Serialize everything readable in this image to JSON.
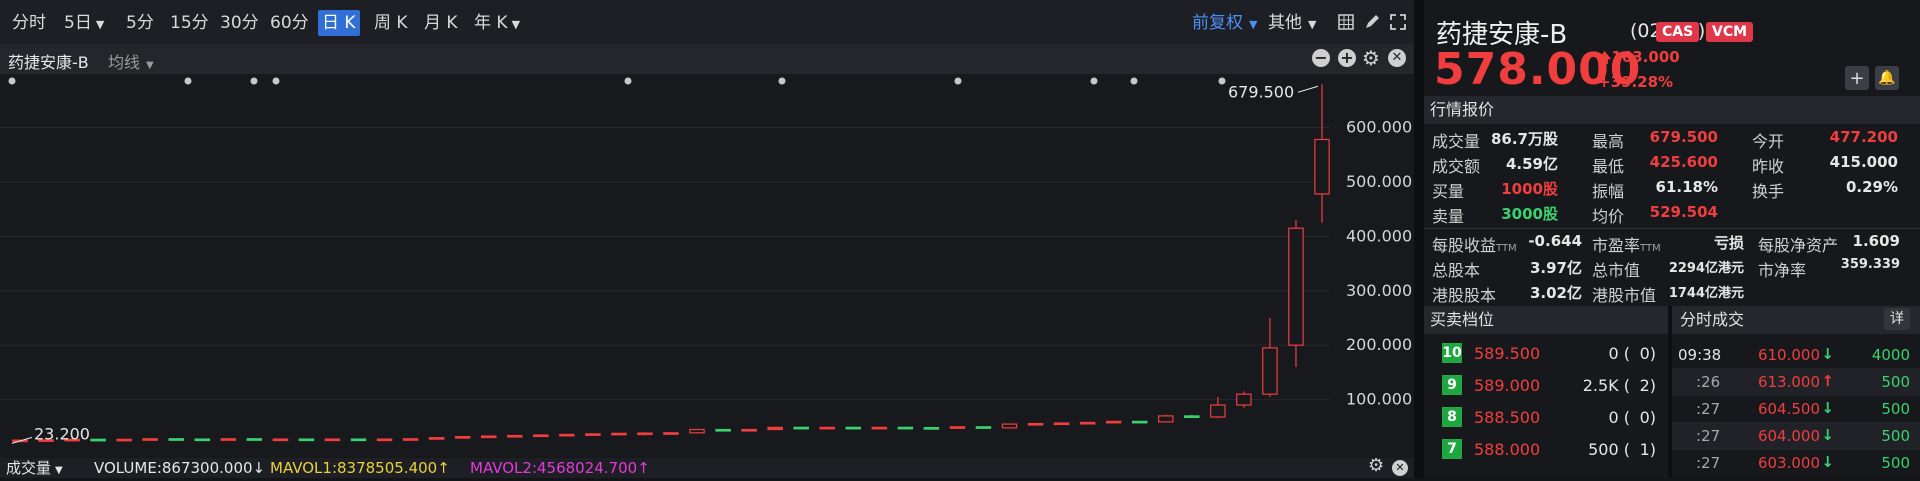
{
  "toolbar": {
    "timeframes": [
      {
        "label": "分时",
        "caret": false
      },
      {
        "label": "5日",
        "caret": true
      },
      {
        "label": "5分",
        "caret": false
      },
      {
        "label": "15分",
        "caret": false
      },
      {
        "label": "30分",
        "caret": false
      },
      {
        "label": "60分",
        "caret": false
      },
      {
        "label": "日 K",
        "caret": false,
        "active": true
      },
      {
        "label": "周 K",
        "caret": false
      },
      {
        "label": "月 K",
        "caret": false
      },
      {
        "label": "年 K",
        "caret": true
      }
    ],
    "adjust_label": "前复权",
    "other_label": "其他"
  },
  "subbar": {
    "stock_name": "药捷安康-B",
    "indicator_label": "均线"
  },
  "volume_bar": {
    "label": "成交量",
    "volume": "VOLUME:867300.000↓",
    "mavol1": "MAVOL1:8378505.400↑",
    "mavol2": "MAVOL2:4568024.700↑"
  },
  "chart_data": {
    "type": "candlestick",
    "title": "",
    "xlabel": "",
    "ylabel": "",
    "ylim": [
      0,
      680
    ],
    "y_ticks": [
      "600.000",
      "500.000",
      "400.000",
      "300.000",
      "200.000",
      "100.000"
    ],
    "y_tick_values": [
      600,
      500,
      400,
      300,
      200,
      100
    ],
    "annotations": {
      "high": "679.500",
      "low": "23.200"
    },
    "candles": [
      {
        "o": 25,
        "c": 25.5,
        "h": 26,
        "l": 23.2
      },
      {
        "o": 25.5,
        "c": 26,
        "h": 27,
        "l": 25
      },
      {
        "o": 26,
        "c": 27,
        "h": 28,
        "l": 25
      },
      {
        "o": 27,
        "c": 26.5,
        "h": 28,
        "l": 26
      },
      {
        "o": 26.5,
        "c": 27,
        "h": 28,
        "l": 26
      },
      {
        "o": 27,
        "c": 28,
        "h": 29,
        "l": 26
      },
      {
        "o": 28,
        "c": 27.5,
        "h": 29,
        "l": 27
      },
      {
        "o": 27.5,
        "c": 27,
        "h": 28,
        "l": 26
      },
      {
        "o": 27,
        "c": 28,
        "h": 29,
        "l": 26
      },
      {
        "o": 28,
        "c": 27,
        "h": 29,
        "l": 26
      },
      {
        "o": 27,
        "c": 27.5,
        "h": 28,
        "l": 26
      },
      {
        "o": 27.5,
        "c": 27,
        "h": 28,
        "l": 26
      },
      {
        "o": 27,
        "c": 27.5,
        "h": 28,
        "l": 26
      },
      {
        "o": 27.5,
        "c": 27,
        "h": 28,
        "l": 26
      },
      {
        "o": 27,
        "c": 27.5,
        "h": 28,
        "l": 26
      },
      {
        "o": 27.5,
        "c": 28,
        "h": 29,
        "l": 27
      },
      {
        "o": 28,
        "c": 30,
        "h": 31,
        "l": 27
      },
      {
        "o": 30,
        "c": 32,
        "h": 33,
        "l": 29
      },
      {
        "o": 32,
        "c": 33,
        "h": 34,
        "l": 31
      },
      {
        "o": 33,
        "c": 34,
        "h": 35,
        "l": 32
      },
      {
        "o": 34,
        "c": 35,
        "h": 36,
        "l": 33
      },
      {
        "o": 35,
        "c": 36,
        "h": 37,
        "l": 34
      },
      {
        "o": 36,
        "c": 37,
        "h": 38,
        "l": 35
      },
      {
        "o": 37,
        "c": 38,
        "h": 39,
        "l": 36
      },
      {
        "o": 38,
        "c": 38.5,
        "h": 40,
        "l": 37
      },
      {
        "o": 38.5,
        "c": 39,
        "h": 40,
        "l": 37
      },
      {
        "o": 39,
        "c": 45,
        "h": 46,
        "l": 38
      },
      {
        "o": 45,
        "c": 44,
        "h": 46,
        "l": 43
      },
      {
        "o": 44,
        "c": 45,
        "h": 46,
        "l": 43
      },
      {
        "o": 45,
        "c": 49,
        "h": 50,
        "l": 44
      },
      {
        "o": 49,
        "c": 48,
        "h": 50,
        "l": 47
      },
      {
        "o": 48,
        "c": 49,
        "h": 50,
        "l": 47
      },
      {
        "o": 49,
        "c": 48,
        "h": 50,
        "l": 47
      },
      {
        "o": 48,
        "c": 49,
        "h": 50,
        "l": 47
      },
      {
        "o": 49,
        "c": 48.5,
        "h": 50,
        "l": 47
      },
      {
        "o": 48.5,
        "c": 48,
        "h": 50,
        "l": 47
      },
      {
        "o": 48,
        "c": 50,
        "h": 51,
        "l": 47
      },
      {
        "o": 50,
        "c": 48,
        "h": 51,
        "l": 47
      },
      {
        "o": 48,
        "c": 55,
        "h": 56,
        "l": 47
      },
      {
        "o": 55,
        "c": 56,
        "h": 57,
        "l": 54
      },
      {
        "o": 56,
        "c": 57,
        "h": 58,
        "l": 55
      },
      {
        "o": 57,
        "c": 58,
        "h": 59,
        "l": 56
      },
      {
        "o": 58,
        "c": 60,
        "h": 61,
        "l": 57
      },
      {
        "o": 60,
        "c": 59,
        "h": 61,
        "l": 58
      },
      {
        "o": 59,
        "c": 70,
        "h": 72,
        "l": 58
      },
      {
        "o": 70,
        "c": 68,
        "h": 72,
        "l": 66
      },
      {
        "o": 68,
        "c": 90,
        "h": 105,
        "l": 66
      },
      {
        "o": 90,
        "c": 110,
        "h": 115,
        "l": 85
      },
      {
        "o": 110,
        "c": 195,
        "h": 250,
        "l": 105
      },
      {
        "o": 200,
        "c": 415,
        "h": 430,
        "l": 160
      },
      {
        "o": 478,
        "c": 578,
        "h": 679.5,
        "l": 425
      }
    ],
    "event_markers": 11
  },
  "quote": {
    "name": "药捷安康-B",
    "code": "(02617)",
    "badges": [
      "CAS",
      "VCM"
    ],
    "price": "578.000",
    "change": "163.000",
    "change_arrow": "🡅",
    "change_pct": "+39.28%",
    "section_title": "行情报价",
    "rows": [
      [
        {
          "l": "成交量",
          "v": "86.7万股",
          "c": "white"
        },
        {
          "l": "最高",
          "v": "679.500",
          "c": "red"
        },
        {
          "l": "今开",
          "v": "477.200",
          "c": "red"
        }
      ],
      [
        {
          "l": "成交额",
          "v": "4.59亿",
          "c": "white"
        },
        {
          "l": "最低",
          "v": "425.600",
          "c": "red"
        },
        {
          "l": "昨收",
          "v": "415.000",
          "c": "white"
        }
      ],
      [
        {
          "l": "买量",
          "v": "1000股",
          "c": "red"
        },
        {
          "l": "振幅",
          "v": "61.18%",
          "c": "white"
        },
        {
          "l": "换手",
          "v": "0.29%",
          "c": "white"
        }
      ],
      [
        {
          "l": "卖量",
          "v": "3000股",
          "c": "green"
        },
        {
          "l": "均价",
          "v": "529.504",
          "c": "red"
        },
        {
          "l": "",
          "v": "",
          "c": "white"
        }
      ]
    ],
    "rows2": [
      [
        {
          "l": "每股收益",
          "sub": "TTM",
          "v": "-0.644"
        },
        {
          "l": "市盈率",
          "sub": "TTM",
          "v": "亏损"
        },
        {
          "l": "每股净资产",
          "v": "1.609"
        }
      ],
      [
        {
          "l": "总股本",
          "v": "3.97亿"
        },
        {
          "l": "总市值",
          "v": "2294亿港元"
        },
        {
          "l": "市净率",
          "v": "359.339"
        }
      ],
      [
        {
          "l": "港股股本",
          "v": "3.02亿"
        },
        {
          "l": "港股市值",
          "v": "1744亿港元"
        },
        {
          "l": "",
          "v": ""
        }
      ]
    ]
  },
  "orderbook": {
    "title": "买卖档位",
    "rows": [
      {
        "level": "10",
        "price": "589.500",
        "qty": "0 (",
        "orders": "0)"
      },
      {
        "level": "9",
        "price": "589.000",
        "qty": "2.5K (",
        "orders": "2)"
      },
      {
        "level": "8",
        "price": "588.500",
        "qty": "0 (",
        "orders": "0)"
      },
      {
        "level": "7",
        "price": "588.000",
        "qty": "500 (",
        "orders": "1)"
      }
    ]
  },
  "timesales": {
    "title": "分时成交",
    "detail_label": "详",
    "rows": [
      {
        "time": "09:38",
        "price": "610.000",
        "dir": "down",
        "vol": "4000"
      },
      {
        "time": ":26",
        "price": "613.000",
        "dir": "up",
        "vol": "500"
      },
      {
        "time": ":27",
        "price": "604.500",
        "dir": "down",
        "vol": "500"
      },
      {
        "time": ":27",
        "price": "604.000",
        "dir": "down",
        "vol": "500"
      },
      {
        "time": ":27",
        "price": "603.000",
        "dir": "down",
        "vol": "500"
      }
    ]
  }
}
